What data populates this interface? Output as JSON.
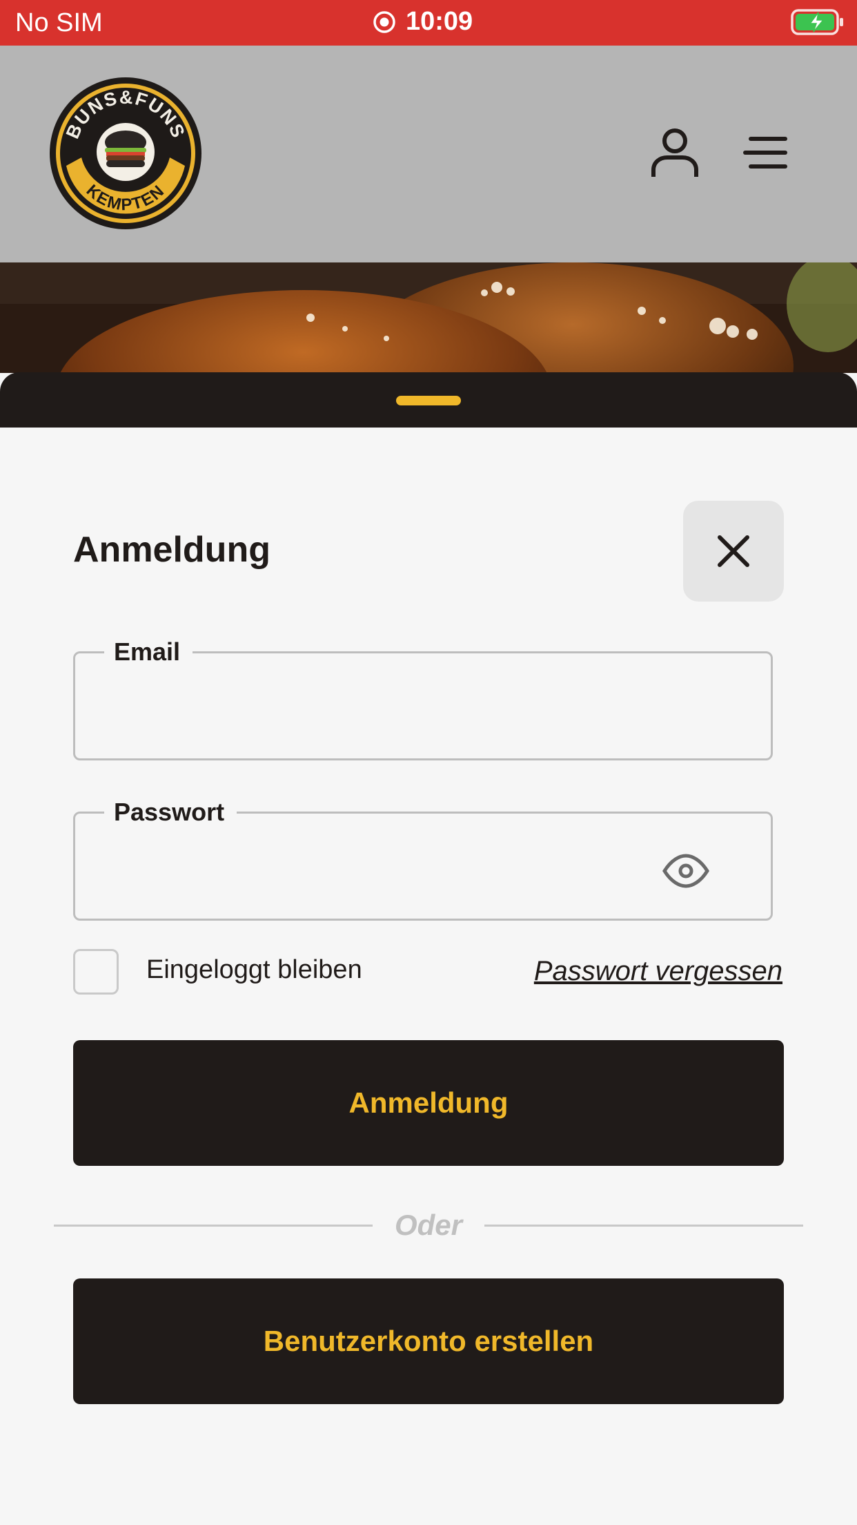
{
  "status_bar": {
    "carrier": "No SIM",
    "time": "10:09",
    "battery_color": "#3cc350"
  },
  "header": {
    "logo": {
      "top_text": "BUNS&FUNS",
      "bottom_text": "KEMPTEN"
    },
    "icons": [
      "user-icon",
      "menu-icon"
    ]
  },
  "colors": {
    "status_bar": "#d8322d",
    "header": "#b5b5b5",
    "accent": "#f0b82a",
    "dark": "#201b19",
    "background": "#f6f6f6"
  },
  "login": {
    "title": "Anmeldung",
    "email_label": "Email",
    "email_value": "",
    "password_label": "Passwort",
    "password_value": "",
    "remember_label": "Eingeloggt bleiben",
    "remember_checked": false,
    "forgot_link": "Passwort vergessen",
    "submit_label": "Anmeldung",
    "divider_text": "Oder",
    "register_label": "Benutzerkonto erstellen"
  }
}
